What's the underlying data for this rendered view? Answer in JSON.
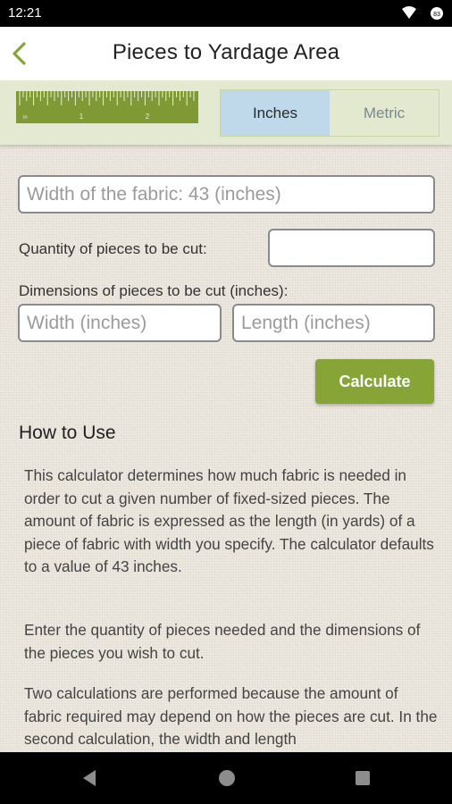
{
  "status_bar": {
    "time": "12:21"
  },
  "app_bar": {
    "title": "Pieces to Yardage Area"
  },
  "ruler": {
    "labels": [
      "in",
      "1",
      "2"
    ]
  },
  "unit_toggle": {
    "inches_label": "Inches",
    "metric_label": "Metric",
    "selected": "Inches"
  },
  "form": {
    "fabric_width_placeholder": "Width of the fabric: 43 (inches)",
    "quantity_label": "Quantity of pieces to be cut:",
    "quantity_value": "",
    "dimensions_label": "Dimensions of pieces to be cut (inches):",
    "width_placeholder": "Width (inches)",
    "length_placeholder": "Length (inches)",
    "calculate_label": "Calculate"
  },
  "how_to_use": {
    "title": "How to Use",
    "paragraphs": [
      "This calculator determines how much fabric is needed in order to cut a given number of fixed-sized pieces. The amount of fabric is expressed as the length (in yards) of a piece of fabric with width you specify. The calculator defaults to a value of 43 inches.",
      "Enter the quantity of pieces needed and the dimensions of the pieces you wish to cut.",
      "Two calculations are performed because the amount of fabric required may depend on how the pieces are cut. In the second calculation, the width and length"
    ]
  },
  "colors": {
    "accent_green": "#86a536",
    "toolbar_bg": "#e4ead2",
    "selected_tab": "#bfd8ea",
    "ruler_green": "#7f9a34"
  }
}
